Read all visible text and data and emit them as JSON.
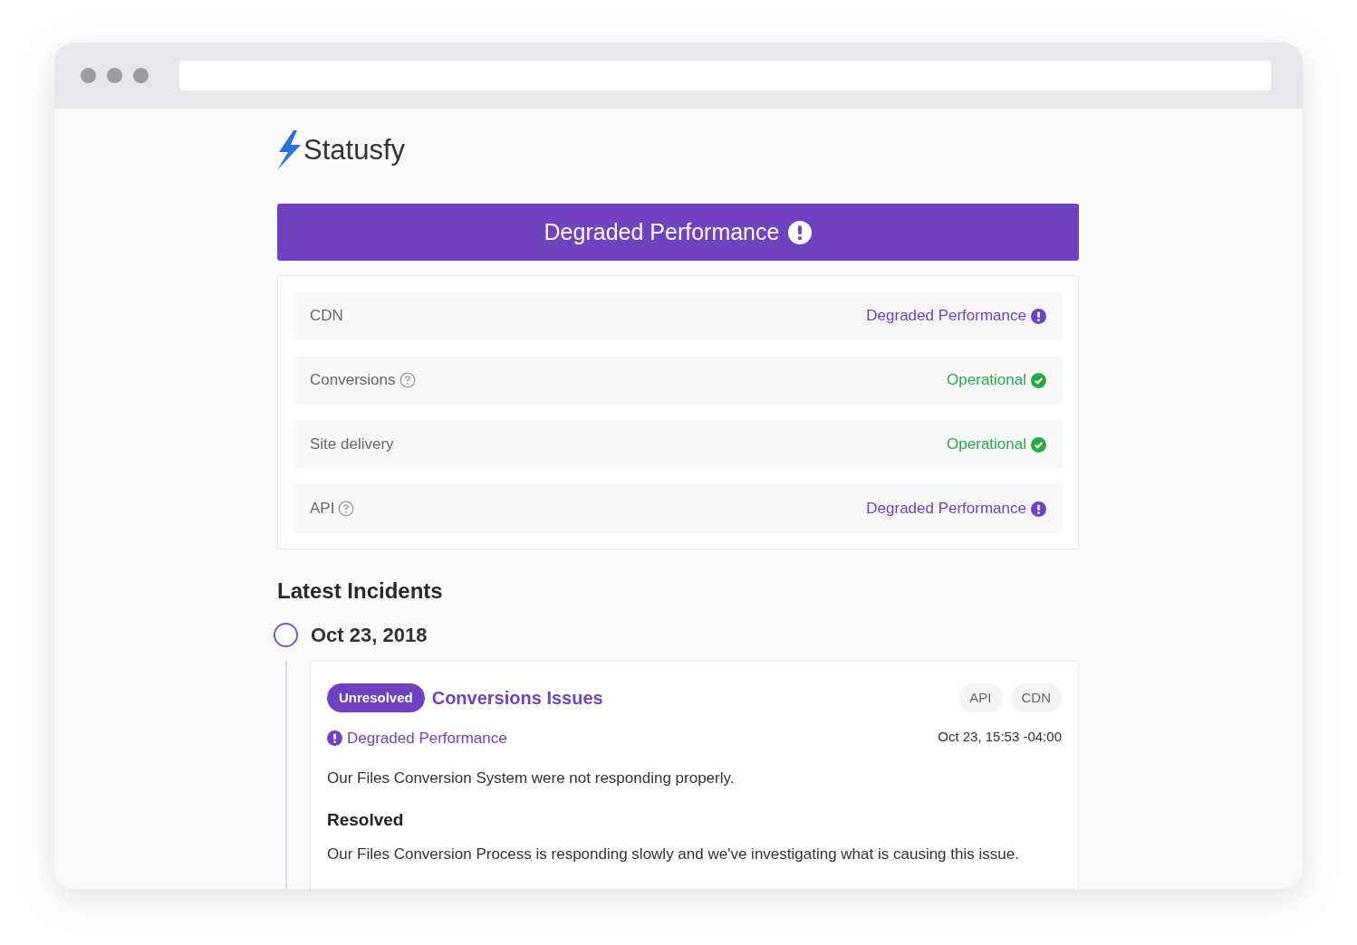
{
  "brand": {
    "name": "Statusfy"
  },
  "banner": {
    "text": "Degraded Performance",
    "kind": "degraded"
  },
  "services": [
    {
      "name": "CDN",
      "help": false,
      "status": "Degraded Performance",
      "kind": "degraded"
    },
    {
      "name": "Conversions",
      "help": true,
      "status": "Operational",
      "kind": "operational"
    },
    {
      "name": "Site delivery",
      "help": false,
      "status": "Operational",
      "kind": "operational"
    },
    {
      "name": "API",
      "help": true,
      "status": "Degraded Performance",
      "kind": "degraded"
    }
  ],
  "incidents": {
    "title": "Latest Incidents",
    "days": [
      {
        "date": "Oct 23, 2018",
        "items": [
          {
            "badge": "Unresolved",
            "title": "Conversions Issues",
            "tags": [
              "API",
              "CDN"
            ],
            "severity": "Degraded Performance",
            "kind": "degraded",
            "time": "Oct 23, 15:53 -04:00",
            "description": "Our Files Conversion System were not responding properly.",
            "update_title": "Resolved",
            "update_text": "Our Files Conversion Process is responding slowly and we've investigating what is causing this issue."
          }
        ]
      }
    ]
  }
}
